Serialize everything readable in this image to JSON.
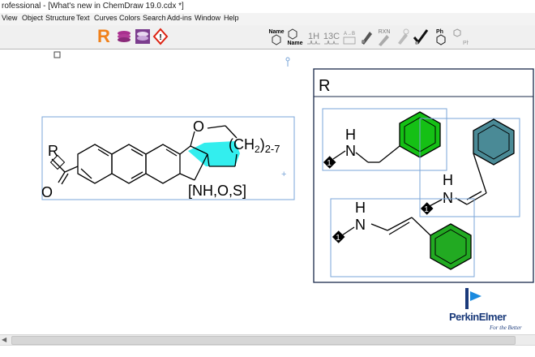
{
  "window": {
    "title": "rofessional - [What's new in ChemDraw 19.0.cdx *]"
  },
  "menu": [
    "View",
    "Object",
    "Structure",
    "Text",
    "Curves",
    "Colors",
    "Search",
    "Add-ins",
    "Window",
    "Help"
  ],
  "toolbar": {
    "r_label": "R",
    "name_label": "Name",
    "name_struct_label": "Name",
    "h_label": "1H",
    "c_label": "13C",
    "ab_label": "A→B",
    "rxn_label": "RXN",
    "ph_label": "Ph",
    "ph2_label": "Ph"
  },
  "molecule": {
    "r_label": "R",
    "o_carbonyl": "O",
    "ring_o": "O",
    "chain": "(CH",
    "chain_sub": "2",
    "chain_close": ")",
    "chain_range": "2-7",
    "hetero": "[NH,O,S]",
    "plus_mark": "+"
  },
  "rgroup_table": {
    "title": "R",
    "attach_number": "1",
    "h_label": "H",
    "n_label": "N"
  },
  "logo": {
    "brand": "PerkinElmer",
    "tagline": "For the Better"
  },
  "colors": {
    "green": "#15c015",
    "green_dark": "#22aa22",
    "teal": "#4a8a96",
    "cyan": "#33eeee",
    "selection": "#7aa6d8"
  }
}
